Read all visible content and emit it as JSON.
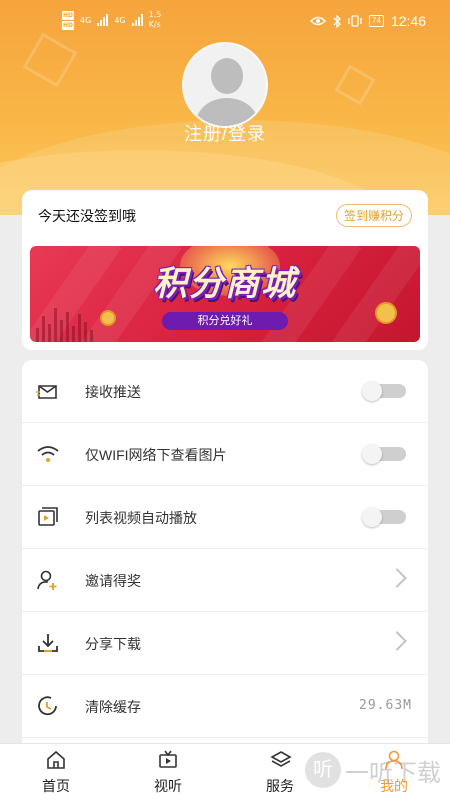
{
  "status_bar": {
    "hd1": "HD",
    "hd2": "HD",
    "net1": "4G",
    "net2": "4G",
    "speed_value": "1.5",
    "speed_unit": "K/s",
    "battery": "74",
    "time": "12:46"
  },
  "profile": {
    "login_label": "注册/登录"
  },
  "checkin": {
    "status_text": "今天还没签到哦",
    "button_label": "签到赚积分"
  },
  "banner": {
    "title": "积分商城",
    "subtitle": "积分兑好礼"
  },
  "settings": {
    "items": [
      {
        "label": "接收推送",
        "icon": "envelope-icon",
        "control": "toggle",
        "enabled": false
      },
      {
        "label": "仅WIFI网络下查看图片",
        "icon": "wifi-icon",
        "control": "toggle",
        "enabled": false
      },
      {
        "label": "列表视频自动播放",
        "icon": "video-icon",
        "control": "toggle",
        "enabled": false
      },
      {
        "label": "邀请得奖",
        "icon": "invite-user-icon",
        "control": "chevron"
      },
      {
        "label": "分享下载",
        "icon": "download-icon",
        "control": "chevron"
      },
      {
        "label": "清除缓存",
        "icon": "clear-cache-icon",
        "control": "value",
        "value": "29.63M"
      }
    ]
  },
  "bottom_nav": {
    "items": [
      {
        "label": "首页",
        "icon": "home-icon"
      },
      {
        "label": "视听",
        "icon": "tv-icon"
      },
      {
        "label": "服务",
        "icon": "layers-icon"
      },
      {
        "label": "我的",
        "icon": "user-icon",
        "active": true
      }
    ],
    "active_color": "#f29b33"
  },
  "watermark": {
    "glyph": "听",
    "text": "一听下载"
  },
  "colors": {
    "header_orange": "#f7a63c",
    "checkin_button": "#e2a12e",
    "banner_red": "#d9223f",
    "banner_purple": "#6e1bb0"
  }
}
